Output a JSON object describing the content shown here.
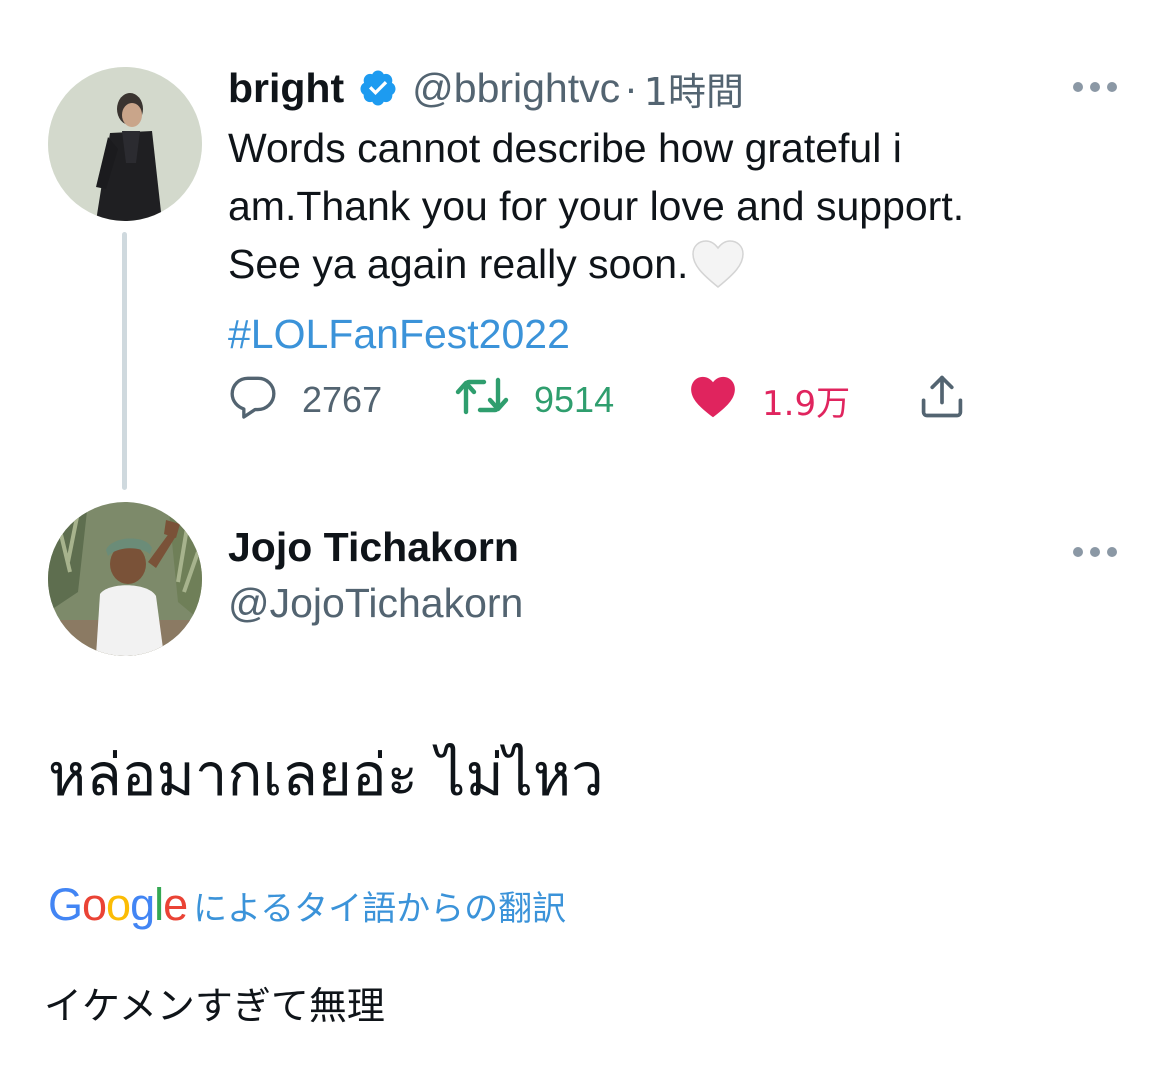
{
  "tweet1": {
    "name": "bright",
    "handle": "@bbrightvc",
    "separator": "·",
    "time": "1時間",
    "text_lines": [
      "Words cannot describe how grateful i",
      "am.Thank you for your love and support.",
      "See ya again really soon."
    ],
    "hashtag": "#LOLFanFest2022",
    "actions": {
      "reply_count": "2767",
      "retweet_count": "9514",
      "like_count": "1.9万"
    },
    "colors": {
      "retweet": "#2f9e6e",
      "like": "#e0245e",
      "link": "#3b93d9",
      "verified": "#1d9bf0"
    }
  },
  "tweet2": {
    "name": "Jojo Tichakorn",
    "handle": "@JojoTichakorn",
    "text": "หล่อมากเลยอ่ะ ไม่ไหว",
    "translation_label": "によるタイ語からの翻訳",
    "translated_text": "イケメンすぎて無理"
  },
  "google_logo": {
    "letters": [
      "G",
      "o",
      "o",
      "g",
      "l",
      "e"
    ],
    "colors": [
      "#4285f4",
      "#ea4335",
      "#fbbc05",
      "#4285f4",
      "#34a853",
      "#ea4335"
    ]
  },
  "icons": {
    "verified": "verified-badge-icon",
    "more": "more-icon",
    "reply": "reply-icon",
    "retweet": "retweet-icon",
    "like": "heart-icon",
    "share": "share-icon",
    "white_heart": "white-heart-emoji-icon"
  }
}
